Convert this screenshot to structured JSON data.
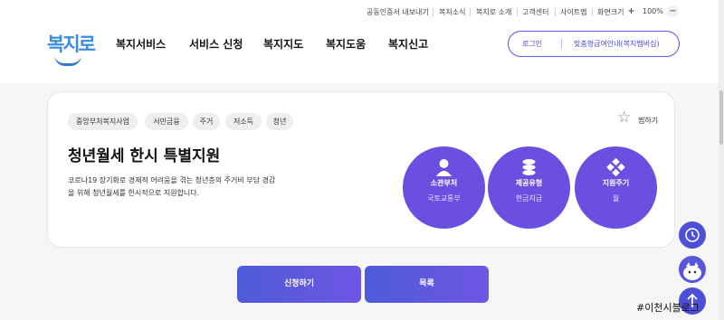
{
  "util_bar": {
    "items": [
      "공동인증서 내보내기",
      "복지소식",
      "복지로 소개",
      "고객센터",
      "사이트맵"
    ],
    "zoom_label": "화면크기",
    "zoom_plus": "+",
    "zoom_value": "100%",
    "zoom_minus": "−"
  },
  "header": {
    "logo_text": "복지로",
    "menu": [
      "복지서비스",
      "서비스 신청",
      "복지지도",
      "복지도움",
      "복지신고"
    ],
    "login_label": "로그인",
    "bokjimember_label": "맞춤형급여안내(복지멤버십)"
  },
  "card": {
    "tags": [
      "중앙부처복지사업",
      "서민금융",
      "주거",
      "저소득",
      "청년"
    ],
    "favorite_label": "찜하기",
    "title": "청년월세 한시 특별지원",
    "description": "코로나19 장기화로 경제적 어려움을 겪는 청년층의 주거비 부담 경감을 위해 청년월세를 한시적으로 지원합니다.",
    "info": [
      {
        "label": "소관부처",
        "value": "국토교통부",
        "icon": "person-icon"
      },
      {
        "label": "제공유형",
        "value": "현금지급",
        "icon": "coins-icon"
      },
      {
        "label": "지원주기",
        "value": "월",
        "icon": "dots-icon"
      }
    ],
    "accent_color": "#6a4fe0"
  },
  "actions": {
    "apply_label": "신청하기",
    "list_label": "목록"
  },
  "watermark": "#이천시블로그"
}
